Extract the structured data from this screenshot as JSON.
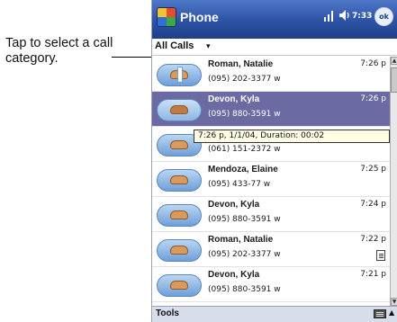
{
  "callout": {
    "text": "Tap to select a call category."
  },
  "titlebar": {
    "app_title": "Phone",
    "clock": "7:33",
    "ok_label": "ok"
  },
  "category": {
    "label": "All Calls",
    "arrow": "▾"
  },
  "calls": [
    {
      "name": "Roman, Natalie",
      "time": "7:26 p",
      "number": "(095) 202-3377 w",
      "selected": false,
      "icon": "outgoing-call-icon"
    },
    {
      "name": "Devon, Kyla",
      "time": "7:26 p",
      "number": "(095) 880-3591 w",
      "selected": true,
      "icon": "missed-call-icon"
    },
    {
      "name": "",
      "time": "",
      "number": "(061) 151-2372 w",
      "selected": false,
      "icon": "incoming-call-icon"
    },
    {
      "name": "Mendoza, Elaine",
      "time": "7:25 p",
      "number": "(095) 433-77 w",
      "selected": false,
      "icon": "incoming-call-icon"
    },
    {
      "name": "Devon, Kyla",
      "time": "7:24 p",
      "number": "(095) 880-3591 w",
      "selected": false,
      "icon": "incoming-call-icon"
    },
    {
      "name": "Roman, Natalie",
      "time": "7:22 p",
      "number": "(095) 202-3377 w",
      "selected": false,
      "icon": "incoming-call-icon",
      "note": true
    },
    {
      "name": "Devon, Kyla",
      "time": "7:21 p",
      "number": "(095) 880-3591 w",
      "selected": false,
      "icon": "incoming-call-icon"
    }
  ],
  "tooltip": {
    "text": "7:26 p, 1/1/04, Duration: 00:02"
  },
  "menubar": {
    "tools_label": "Tools",
    "sip_arrow": "▲"
  },
  "colors": {
    "titlebar": "#2f55a8",
    "selection": "#6b6aa3",
    "tooltip_bg": "#fffde4"
  }
}
